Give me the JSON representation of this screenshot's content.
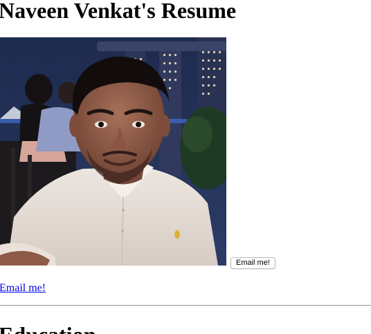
{
  "page": {
    "title": "Naveen Venkat's Resume"
  },
  "profile_photo": {
    "alt": "Photo of Naveen Venkat"
  },
  "contact": {
    "button_label": "Email me!",
    "link_label": "Email me!"
  },
  "sections": {
    "education_heading": "Education"
  },
  "colors": {
    "link": "#0000ee",
    "text": "#000000",
    "background": "#ffffff",
    "divider": "#a0a0a0"
  }
}
